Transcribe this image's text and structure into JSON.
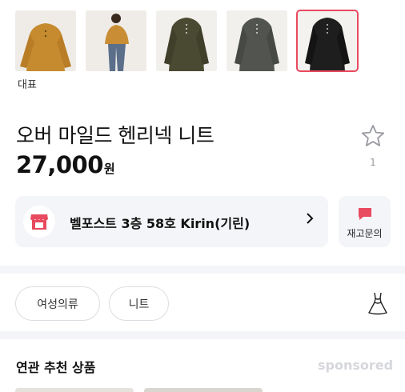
{
  "gallery": {
    "thumbnails": [
      {
        "name": "mustard-knit-front",
        "color": "#c68b2e",
        "selected": false
      },
      {
        "name": "mustard-knit-model",
        "color": "#c98d35",
        "selected": false
      },
      {
        "name": "khaki-knit",
        "color": "#4a4a32",
        "selected": false
      },
      {
        "name": "charcoal-knit",
        "color": "#52554f",
        "selected": false
      },
      {
        "name": "black-knit",
        "color": "#1e1e1e",
        "selected": true
      }
    ],
    "representative_label": "대표"
  },
  "product": {
    "title": "오버 마일드 헨리넥 니트",
    "price": "27,000",
    "price_unit": "원",
    "favorite_count": "1"
  },
  "store": {
    "name": "벨포스트 3층 58호 Kirin(기린)",
    "chevron": "›",
    "brand_color": "#e84a5f"
  },
  "inquiry": {
    "label": "재고문의"
  },
  "categories": [
    {
      "label": "여성의류"
    },
    {
      "label": "니트"
    }
  ],
  "recommendations": {
    "title": "연관 추천 상품",
    "sponsored_label": "sponsored"
  }
}
